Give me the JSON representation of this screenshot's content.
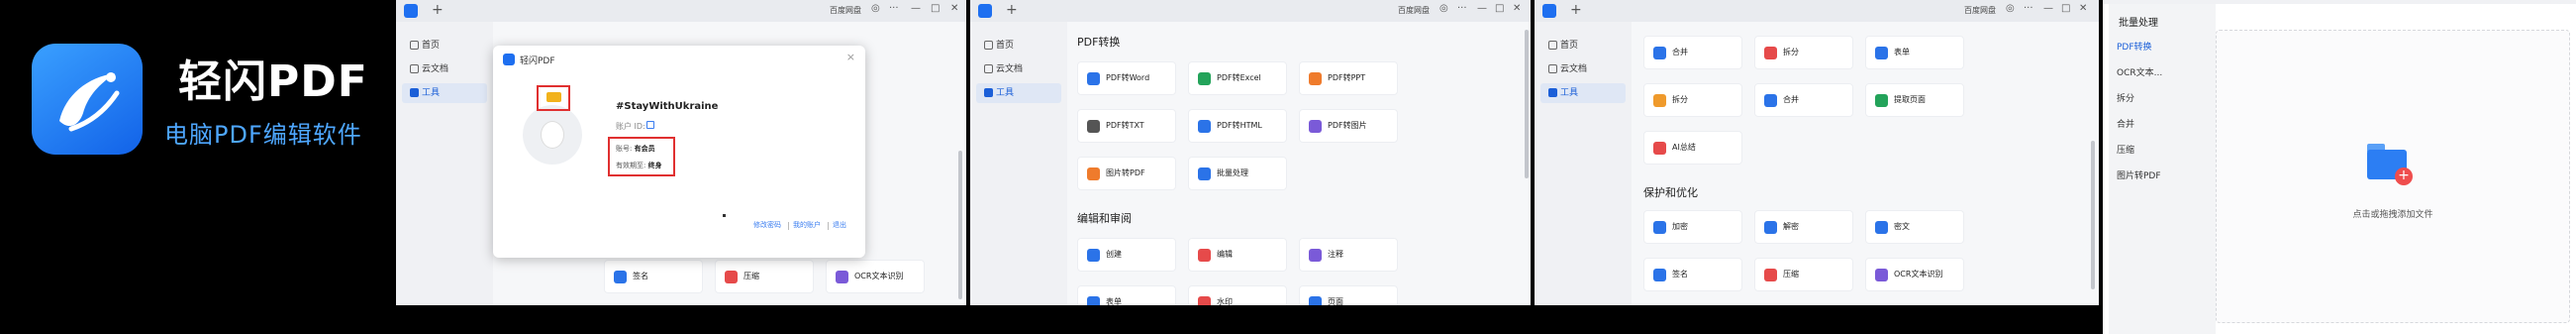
{
  "brand": {
    "name": "轻闪PDF",
    "tagline": "电脑PDF编辑软件"
  },
  "titlebar": {
    "user": "百度网盘",
    "plus": "+",
    "min": "—",
    "max": "□",
    "close": "✕",
    "more": "···"
  },
  "sidebar": {
    "home": "首页",
    "cloud": "云文档",
    "tools": "工具"
  },
  "dialog": {
    "title": "轻闪PDF",
    "close": "×",
    "nickname": "#StayWithUkraine",
    "user_id_label": "账户 ID:",
    "account_label": "账号:",
    "account_value": "有会员",
    "expiry_label": "有效期至:",
    "expiry_value": "终身",
    "links": [
      "修改密码",
      "我的账户",
      "退出"
    ]
  },
  "window1_bottom_tools": [
    "签名",
    "压缩",
    "OCR文本识别"
  ],
  "window2": {
    "section_convert": "PDF转换",
    "convert_tools": [
      "PDF转Word",
      "PDF转Excel",
      "PDF转PPT",
      "PDF转TXT",
      "PDF转HTML",
      "PDF转图片",
      "图片转PDF",
      "批量处理"
    ],
    "section_edit": "编辑和审阅",
    "edit_tools": [
      "创建",
      "编辑",
      "注释",
      "表单",
      "水印",
      "页面"
    ]
  },
  "window3": {
    "top_tools": [
      "合并",
      "拆分",
      "表单",
      "拆分",
      "合并",
      "提取页面",
      "AI总结"
    ],
    "section_protect": "保护和优化",
    "protect_tools": [
      "加密",
      "解密",
      "签名",
      "压缩",
      "密文",
      "OCR文本识别"
    ]
  },
  "batch": {
    "title": "批量处理",
    "items": [
      "PDF转换",
      "OCR文本...",
      "拆分",
      "合并",
      "压缩",
      "图片转PDF"
    ],
    "hint": "点击或拖拽添加文件",
    "folder_plus": "+"
  },
  "colors": {
    "accent": "#1b5fd8",
    "highlight_box": "#e03030",
    "vip_gold": "#f2b21b"
  }
}
